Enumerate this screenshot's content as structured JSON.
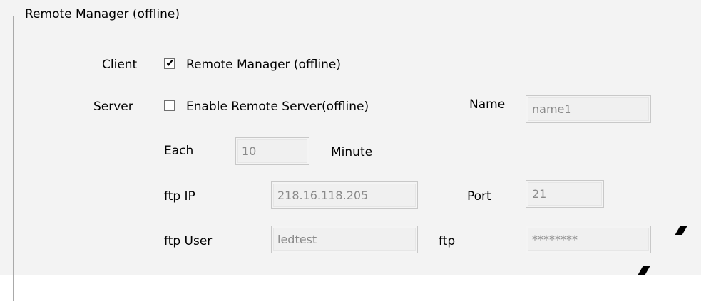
{
  "group": {
    "title": "Remote Manager (offline)"
  },
  "client": {
    "label": "Client",
    "checkbox_label": "Remote Manager (offline)",
    "checked": true
  },
  "server": {
    "label": "Server",
    "checkbox_label": "Enable Remote Server(offline)",
    "checked": false
  },
  "name": {
    "label": "Name",
    "value": "name1"
  },
  "each": {
    "label": "Each",
    "value": "10",
    "unit": "Minute"
  },
  "ftp_ip": {
    "label": "ftp IP",
    "value": "218.16.118.205"
  },
  "port": {
    "label": "Port",
    "value": "21"
  },
  "ftp_user": {
    "label": "ftp User",
    "value": "ledtest"
  },
  "ftp_password": {
    "label": "ftp",
    "value": "********"
  }
}
